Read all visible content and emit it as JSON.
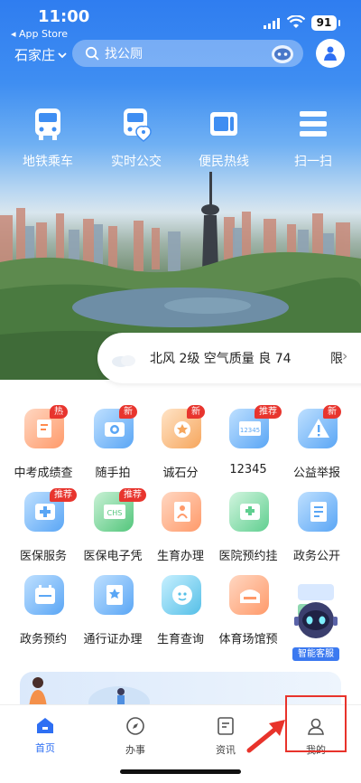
{
  "status_bar": {
    "time": "11:00",
    "back_app": "◂ App Store",
    "battery": "91"
  },
  "header": {
    "city": "石家庄",
    "search_placeholder": "找公厕"
  },
  "quick_nav": [
    {
      "label": "地铁乘车",
      "icon": "bus-icon"
    },
    {
      "label": "实时公交",
      "icon": "live-bus-icon"
    },
    {
      "label": "便民热线",
      "icon": "hotline-icon"
    },
    {
      "label": "扫一扫",
      "icon": "scan-icon"
    }
  ],
  "weather": {
    "text": "北风 2级 空气质量 良 74",
    "tail": "限"
  },
  "services": [
    {
      "label": "中考成绩查",
      "badge": "热",
      "icon": "exam-score-icon",
      "color": "orange"
    },
    {
      "label": "随手拍",
      "badge": "新",
      "icon": "camera-icon",
      "color": "blue"
    },
    {
      "label": "诚石分",
      "badge": "新",
      "icon": "medal-icon",
      "color": "gold"
    },
    {
      "label": "12345",
      "badge": "推荐",
      "icon": "hotline-12345-icon",
      "color": "blue"
    },
    {
      "label": "公益举报",
      "badge": "新",
      "icon": "warning-icon",
      "color": "blue"
    },
    {
      "label": "医保服务",
      "badge": "推荐",
      "icon": "medical-insurance-icon",
      "color": "blue"
    },
    {
      "label": "医保电子凭",
      "badge": "推荐",
      "icon": "chs-card-icon",
      "color": "green"
    },
    {
      "label": "生育办理",
      "badge": "",
      "icon": "birth-handle-icon",
      "color": "orange"
    },
    {
      "label": "医院预约挂",
      "badge": "",
      "icon": "hospital-appointment-icon",
      "color": "mint"
    },
    {
      "label": "政务公开",
      "badge": "",
      "icon": "gov-open-icon",
      "color": "blue"
    },
    {
      "label": "政务预约",
      "badge": "",
      "icon": "gov-appointment-icon",
      "color": "blue"
    },
    {
      "label": "通行证办理",
      "badge": "",
      "icon": "pass-permit-icon",
      "color": "blue"
    },
    {
      "label": "生育查询",
      "badge": "",
      "icon": "birth-query-icon",
      "color": "teal"
    },
    {
      "label": "体育场馆预",
      "badge": "",
      "icon": "stadium-icon",
      "color": "orange"
    }
  ],
  "assistant": {
    "label": "智能客服"
  },
  "tabs": [
    {
      "label": "首页",
      "active": true
    },
    {
      "label": "办事",
      "active": false
    },
    {
      "label": "资讯",
      "active": false
    },
    {
      "label": "我的",
      "active": false
    }
  ],
  "colors": {
    "accent": "#2e6ff3",
    "badge": "#e8352e",
    "highlight": "#e8332b"
  }
}
